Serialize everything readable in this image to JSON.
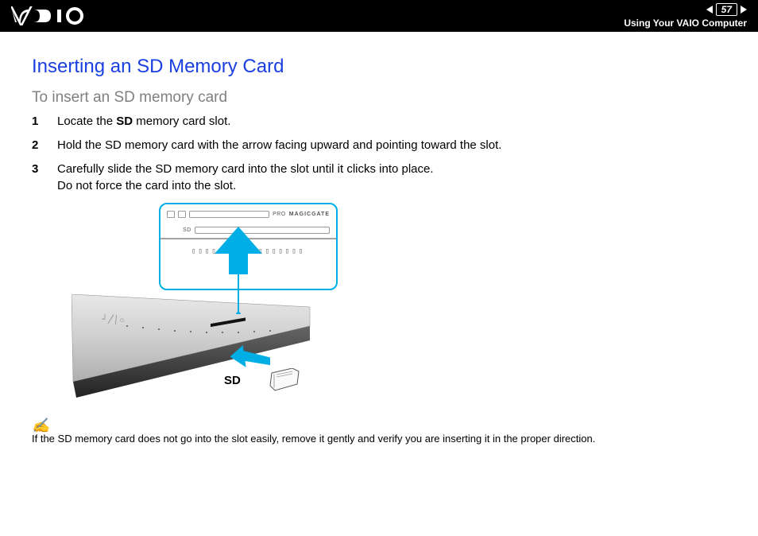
{
  "page_number": "57",
  "breadcrumb": "Using Your VAIO Computer",
  "title": "Inserting an SD Memory Card",
  "subtitle": "To insert an SD memory card",
  "steps": [
    {
      "pre": "Locate the ",
      "bold": "SD",
      "post": " memory card slot."
    },
    {
      "pre": "Hold the SD memory card with the arrow facing upward and pointing toward the slot.",
      "bold": "",
      "post": ""
    },
    {
      "pre": "Carefully slide the SD memory card into the slot until it clicks into place.",
      "bold": "",
      "post": "",
      "line2": "Do not force the card into the slot."
    }
  ],
  "callout_labels": {
    "pro": "PRO",
    "magicgate": "MAGICGATE",
    "sd": "SD"
  },
  "diagram_sd_label": "SD",
  "note_text": "If the SD memory card does not go into the slot easily, remove it gently and verify you are inserting it in the proper direction.",
  "colors": {
    "heading": "#1a3fe0",
    "accent": "#00aee6"
  }
}
